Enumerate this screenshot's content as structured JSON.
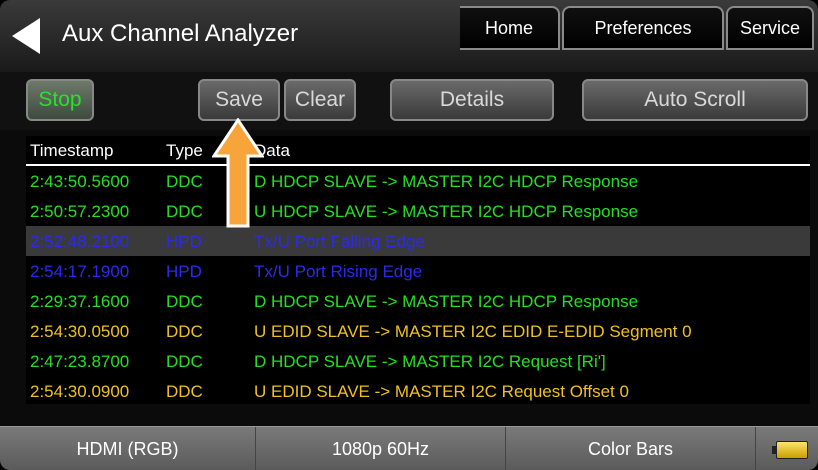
{
  "header": {
    "title": "Aux Channel Analyzer",
    "tabs": [
      "Home",
      "Preferences",
      "Service"
    ]
  },
  "toolbar": {
    "stop": "Stop",
    "save": "Save",
    "clear": "Clear",
    "details": "Details",
    "auto_scroll": "Auto Scroll"
  },
  "table": {
    "columns": [
      "Timestamp",
      "Type",
      "Data"
    ],
    "rows": [
      {
        "timestamp": "2:43:50.5600",
        "type": "DDC",
        "data": "D HDCP  SLAVE -> MASTER I2C HDCP Response",
        "color": "#22e022"
      },
      {
        "timestamp": "2:50:57.2300",
        "type": "DDC",
        "data": "U HDCP  SLAVE -> MASTER I2C HDCP Response",
        "color": "#22e022"
      },
      {
        "timestamp": "2:52:48.2100",
        "type": "HPD",
        "data": "Tx/U Port Falling Edge",
        "color": "#2a2af0",
        "selected": true
      },
      {
        "timestamp": "2:54:17.1900",
        "type": "HPD",
        "data": "Tx/U Port Rising Edge",
        "color": "#2a2af0"
      },
      {
        "timestamp": "2:29:37.1600",
        "type": "DDC",
        "data": "D HDCP  SLAVE -> MASTER I2C HDCP Response",
        "color": "#22e022"
      },
      {
        "timestamp": "2:54:30.0500",
        "type": "DDC",
        "data": "U EDID  SLAVE -> MASTER I2C EDID E-EDID Segment 0",
        "color": "#f0c020"
      },
      {
        "timestamp": "2:47:23.8700",
        "type": "DDC",
        "data": "D HDCP  SLAVE -> MASTER I2C Request [Ri']",
        "color": "#22e022"
      },
      {
        "timestamp": "2:54:30.0900",
        "type": "DDC",
        "data": "U EDID  SLAVE -> MASTER I2C Request Offset 0",
        "color": "#f0c020"
      }
    ]
  },
  "footer": {
    "cells": [
      "HDMI (RGB)",
      "1080p 60Hz",
      "Color Bars"
    ]
  },
  "icons": {
    "back": "back-arrow-icon",
    "battery": "battery-icon",
    "annotation": "up-arrow-icon"
  },
  "colors": {
    "accent_green": "#22e022",
    "annotation_orange": "#f7a53a"
  }
}
